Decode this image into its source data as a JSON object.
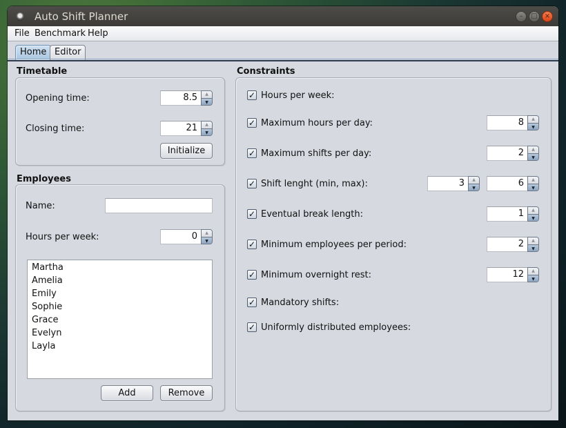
{
  "window": {
    "title": "Auto Shift Planner",
    "controls": {
      "minimize": "–",
      "maximize": "□",
      "close": "×"
    }
  },
  "menu": [
    "File",
    "Benchmark",
    "Help"
  ],
  "tabs": [
    {
      "label": "Home",
      "selected": true
    },
    {
      "label": "Editor",
      "selected": false
    }
  ],
  "timetable": {
    "title": "Timetable",
    "opening_label": "Opening time:",
    "opening_value": "8.5",
    "closing_label": "Closing time:",
    "closing_value": "21",
    "initialize_label": "Initialize"
  },
  "employees": {
    "title": "Employees",
    "name_label": "Name:",
    "name_value": "",
    "hours_label": "Hours per week:",
    "hours_value": "0",
    "list": [
      "Martha",
      "Amelia",
      "Emily",
      "Sophie",
      "Grace",
      "Evelyn",
      "Layla"
    ],
    "add_label": "Add",
    "remove_label": "Remove"
  },
  "constraints": {
    "title": "Constraints",
    "items": [
      {
        "label": "Hours per week:",
        "checked": true,
        "values": []
      },
      {
        "label": "Maximum hours per day:",
        "checked": true,
        "values": [
          "8"
        ]
      },
      {
        "label": "Maximum shifts per day:",
        "checked": true,
        "values": [
          "2"
        ]
      },
      {
        "label": "Shift lenght (min, max):",
        "checked": true,
        "values": [
          "3",
          "6"
        ]
      },
      {
        "label": "Eventual break length:",
        "checked": true,
        "values": [
          "1"
        ]
      },
      {
        "label": "Minimum employees per period:",
        "checked": true,
        "values": [
          "2"
        ]
      },
      {
        "label": "Minimum overnight rest:",
        "checked": true,
        "values": [
          "12"
        ]
      },
      {
        "label": "Mandatory shifts:",
        "checked": true,
        "values": []
      },
      {
        "label": "Uniformly distributed employees:",
        "checked": true,
        "values": []
      }
    ]
  },
  "icons": {
    "check": "✓",
    "spin_up": "▲",
    "spin_down": "▼"
  }
}
